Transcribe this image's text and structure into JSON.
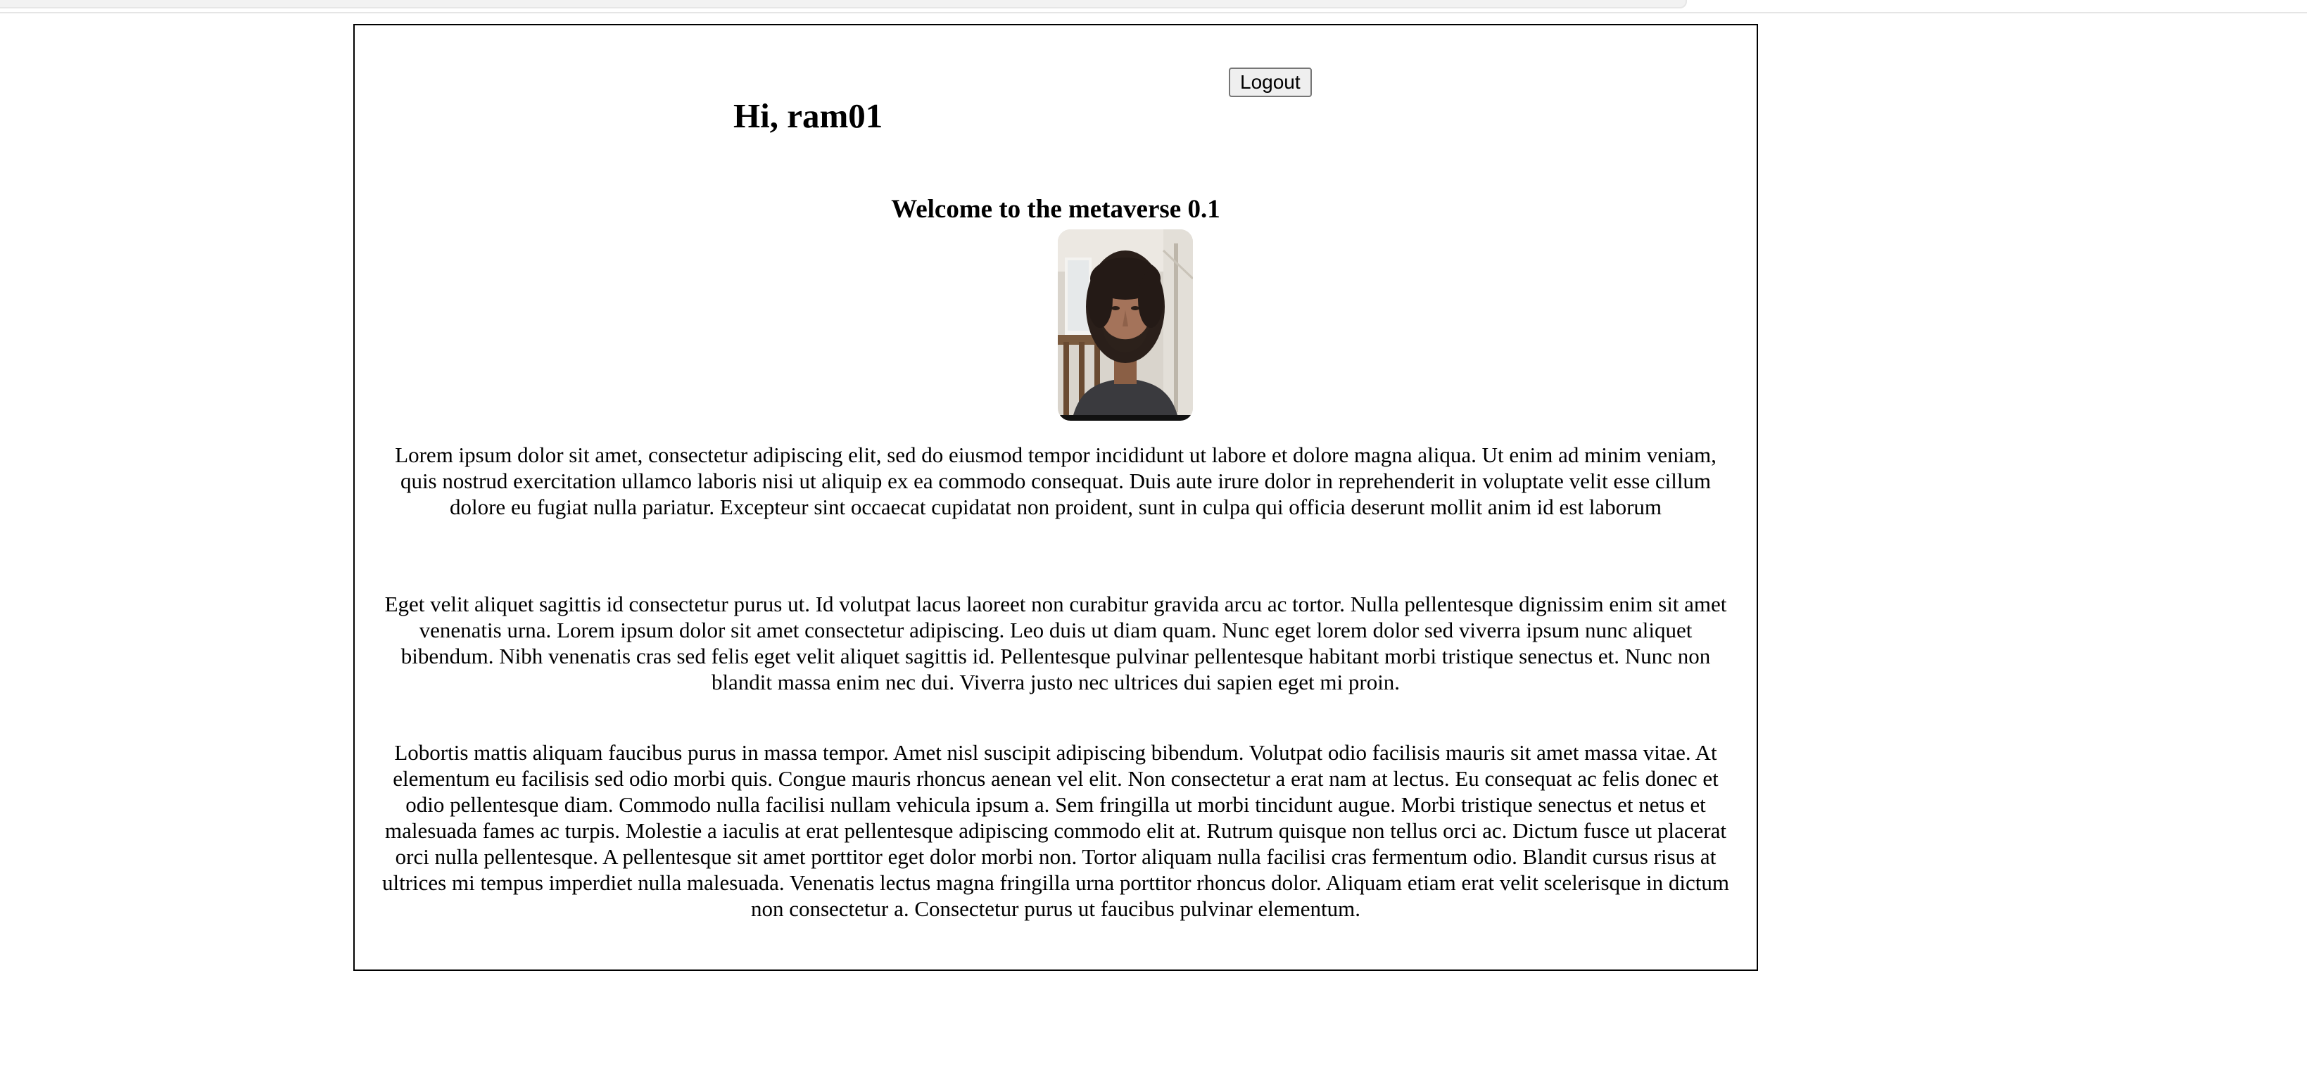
{
  "header": {
    "greeting": "Hi, ram01",
    "logout_label": "Logout"
  },
  "main": {
    "welcome": "Welcome to the metaverse 0.1",
    "avatar_icon": "user-photo",
    "paragraphs": [
      "Lorem ipsum dolor sit amet, consectetur adipiscing elit, sed do eiusmod tempor incididunt ut labore et dolore magna aliqua. Ut enim ad minim veniam, quis nostrud exercitation ullamco laboris nisi ut aliquip ex ea commodo consequat. Duis aute irure dolor in reprehenderit in voluptate velit esse cillum dolore eu fugiat nulla pariatur. Excepteur sint occaecat cupidatat non proident, sunt in culpa qui officia deserunt mollit anim id est laborum",
      "Eget velit aliquet sagittis id consectetur purus ut. Id volutpat lacus laoreet non curabitur gravida arcu ac tortor. Nulla pellentesque dignissim enim sit amet venenatis urna. Lorem ipsum dolor sit amet consectetur adipiscing. Leo duis ut diam quam. Nunc eget lorem dolor sed viverra ipsum nunc aliquet bibendum. Nibh venenatis cras sed felis eget velit aliquet sagittis id. Pellentesque pulvinar pellentesque habitant morbi tristique senectus et. Nunc non blandit massa enim nec dui. Viverra justo nec ultrices dui sapien eget mi proin.",
      "Lobortis mattis aliquam faucibus purus in massa tempor. Amet nisl suscipit adipiscing bibendum. Volutpat odio facilisis mauris sit amet massa vitae. At elementum eu facilisis sed odio morbi quis. Congue mauris rhoncus aenean vel elit. Non consectetur a erat nam at lectus. Eu consequat ac felis donec et odio pellentesque diam. Commodo nulla facilisi nullam vehicula ipsum a. Sem fringilla ut morbi tincidunt augue. Morbi tristique senectus et netus et malesuada fames ac turpis. Molestie a iaculis at erat pellentesque adipiscing commodo elit at. Rutrum quisque non tellus orci ac. Dictum fusce ut placerat orci nulla pellentesque. A pellentesque sit amet porttitor eget dolor morbi non. Tortor aliquam nulla facilisi cras fermentum odio. Blandit cursus risus at ultrices mi tempus imperdiet nulla malesuada. Venenatis lectus magna fringilla urna porttitor rhoncus dolor. Aliquam etiam erat velit scelerisque in dictum non consectetur a. Consectetur purus ut faucibus pulvinar elementum."
    ]
  }
}
